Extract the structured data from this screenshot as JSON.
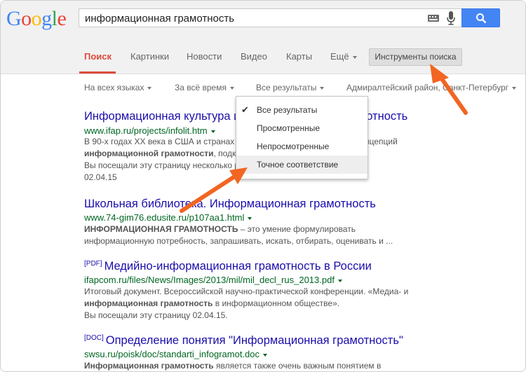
{
  "logo": {
    "letters": [
      {
        "char": "G",
        "color": "#4285f4"
      },
      {
        "char": "o",
        "color": "#ea4335"
      },
      {
        "char": "o",
        "color": "#fbbc05"
      },
      {
        "char": "g",
        "color": "#4285f4"
      },
      {
        "char": "l",
        "color": "#34a853"
      },
      {
        "char": "e",
        "color": "#ea4335"
      }
    ]
  },
  "search": {
    "query": "информационная грамотность",
    "keyboard_icon": "keyboard-icon",
    "mic_icon": "microphone-icon",
    "button_icon": "magnifier-icon"
  },
  "tabs": [
    "Поиск",
    "Картинки",
    "Новости",
    "Видео",
    "Карты",
    "Ещё"
  ],
  "tools_button": "Инструменты поиска",
  "filters": {
    "language": "На всех языках",
    "time": "За всё время",
    "results": "Все результаты",
    "location": "Адмиралтейский район, Санкт-Петербург"
  },
  "dropdown": {
    "items": [
      "Все результаты",
      "Просмотренные",
      "Непросмотренные",
      "Точное соответствие"
    ],
    "checked": "Все результаты"
  },
  "results": [
    {
      "title": "Информационная культура и информационная грамотность",
      "url": "www.ifap.ru/projects/infolit.htm",
      "snippet1": "В 90-х годах XX века в США и странах Западной Европы появляется концепций",
      "snippet2_bold": "информационной грамотности",
      "snippet2": ", подкрепленная ...",
      "visited": "Вы посещали эту страницу несколько раз. Последнее посещение:",
      "visited_date": "02.04.15"
    },
    {
      "title": "Школьная библиотека. Информационная грамотность",
      "url": "www.74-gim76.edusite.ru/p107aa1.html",
      "snippet1_bold": "ИНФОРМАЦИОННАЯ ГРАМОТНОСТЬ",
      "snippet1": " – это умение формулировать",
      "snippet2": "информационную потребность, запрашивать, искать, отбирать, оценивать и ..."
    },
    {
      "tag": "[PDF]",
      "title": "Медийно-информационная грамотность в России",
      "url": "ifapcom.ru/files/News/Images/2013/mil/mil_decl_rus_2013.pdf",
      "snippet1": "Итоговый документ. Всероссийской научно-практической конференции. «Медиа- и",
      "snippet2_bold": "информационная грамотность",
      "snippet2": " в информационном обществе».",
      "visited": "Вы посещали эту страницу 02.04.15."
    },
    {
      "tag": "[DOC]",
      "title": "Определение понятия \"Информационная грамотность\"",
      "url": "swsu.ru/poisk/doc/standarti_infogramot.doc",
      "snippet1_bold": "Информационная грамотность",
      "snippet1": " является также очень важным понятием в"
    }
  ],
  "annotation_color": "#f26522"
}
